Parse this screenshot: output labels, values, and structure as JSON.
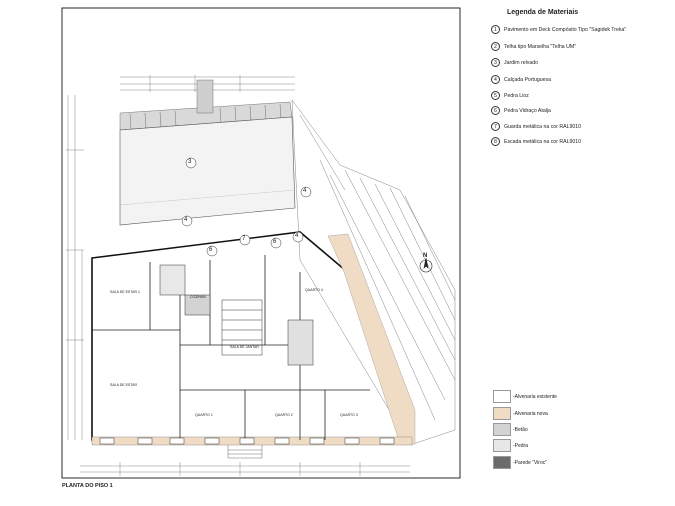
{
  "legend": {
    "title": "Legenda de Materiais",
    "items": [
      {
        "num": "1",
        "label": "Pavimento em Deck Compósito Tipo \"Sagidek Treka\""
      },
      {
        "num": "2",
        "label": "Telha tipo Marselha \"Telha UM\""
      },
      {
        "num": "3",
        "label": "Jardim relvado"
      },
      {
        "num": "4",
        "label": "Calçada Portuguesa"
      },
      {
        "num": "5",
        "label": "Pedra Lioz"
      },
      {
        "num": "6",
        "label": "Pedra Vidraço Atalja"
      },
      {
        "num": "7",
        "label": "Guarda metálica na cor RAL9010"
      },
      {
        "num": "8",
        "label": "Escada metálica na cor RAL9010"
      }
    ]
  },
  "hatch_legend": [
    {
      "label": "-Alvenaria existente",
      "color": "#ffffff"
    },
    {
      "label": "-Alvenaria nova",
      "color": "#f0dcc4"
    },
    {
      "label": "-Betão",
      "color": "#d3d3d3"
    },
    {
      "label": "-Pedra",
      "color": "#e7e7e7"
    },
    {
      "label": "-Parede \"Viroc\"",
      "color": "#6b6b6b"
    }
  ],
  "plan": {
    "title": "PLANTA DO PISO 1",
    "north_label": "N",
    "zone_markers": [
      "3",
      "4",
      "4",
      "4",
      "6",
      "7",
      "6"
    ],
    "room_labels": [
      "SALA DE ESTAR 1",
      "SALA DE ESTAR",
      "QUARTO 1",
      "QUARTO 2",
      "QUARTO 3",
      "QUARTO 4",
      "COZINHA",
      "SALA DE JANTAR"
    ]
  }
}
